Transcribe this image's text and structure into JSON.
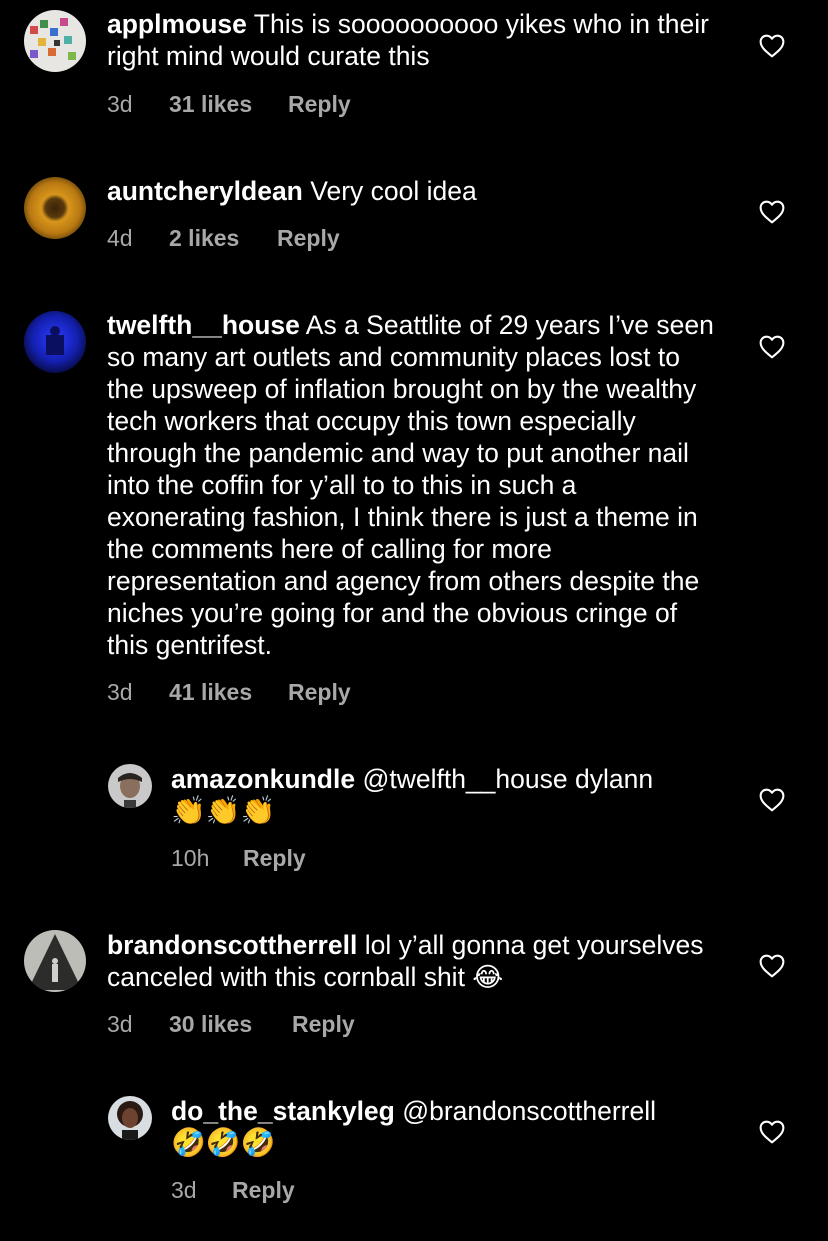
{
  "comments": [
    {
      "username": "applmouse",
      "text": " This is soooooooooo yikes who in their right mind would curate this",
      "time": "3d",
      "likes": "31 likes",
      "reply": "Reply"
    },
    {
      "username": "auntcheryldean",
      "text": " Very cool idea",
      "time": "4d",
      "likes": "2 likes",
      "reply": "Reply"
    },
    {
      "username": "twelfth__house",
      "text": " As a Seattlite of 29 years I’ve seen so many art outlets and community places lost to the upsweep of inflation brought on by the wealthy tech workers that occupy this town especially through the pandemic and way to put another nail into the coffin for y’all to to this in such a exonerating fashion, I think there is just a theme in the comments here of calling for more representation and agency from others despite the niches you’re going for and the obvious cringe of this gentrifest.",
      "time": "3d",
      "likes": "41 likes",
      "reply": "Reply"
    },
    {
      "username": "amazonkundle",
      "text": " @twelfth__house dylann",
      "emoji": "👏👏👏",
      "time": "10h",
      "reply": "Reply"
    },
    {
      "username": "brandonscottherrell",
      "text": " lol y’all gonna get yourselves canceled with this cornball shit 😂",
      "time": "3d",
      "likes": "30 likes",
      "reply": "Reply"
    },
    {
      "username": "do_the_stankyleg",
      "text": " @brandonscottherrell",
      "emoji": "🤣🤣🤣",
      "time": "3d",
      "reply": "Reply"
    }
  ]
}
